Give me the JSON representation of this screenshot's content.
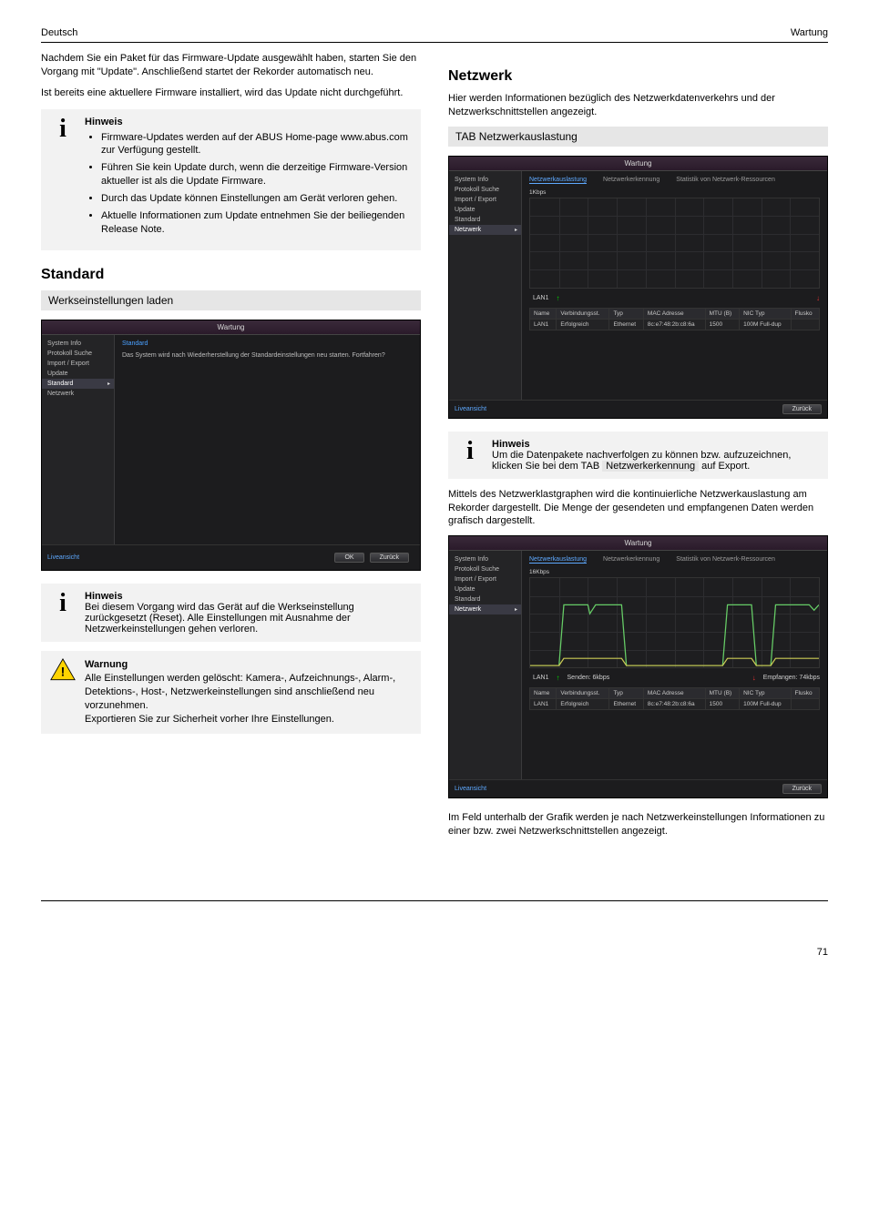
{
  "header": {
    "left": "Deutsch",
    "right": "Wartung"
  },
  "col_left": {
    "p1": "Nachdem Sie ein Paket für das Firmware-Update ausgewählt haben, starten Sie den Vorgang mit \"Update\". Anschließend startet der Rekorder automatisch neu.",
    "p2": "Ist bereits eine aktuellere Firmware installiert, wird das Update nicht durchgeführt.",
    "info1_title": "Hinweis",
    "info1_bullets": [
      "Firmware-Updates werden auf der ABUS Home-page www.abus.com zur Verfügung gestellt.",
      "Führen Sie kein Update durch, wenn die derzeitige Firmware-Version aktueller ist als die Update Firmware.",
      "Durch das Update können Einstellungen am Gerät verloren gehen.",
      "Aktuelle Informationen zum Update entnehmen Sie der beiliegenden Release Note."
    ],
    "section_standard": "Standard",
    "gray_bar_text": "Werkseinstellungen laden",
    "info2_title": "Hinweis",
    "info2_body": "Bei diesem Vorgang wird das Gerät auf die Werkseinstellung zurückgesetzt (Reset). Alle Einstellungen mit Ausnahme der Netzwerkeinstellungen gehen verloren.",
    "warn_title": "Warnung",
    "warn_body": "Alle Einstellungen werden gelöscht: Kamera-, Aufzeichnungs-, Alarm-, Detektions-, Host-, Netzwerkeinstellungen sind anschließend neu vorzunehmen.\nExportieren Sie zur Sicherheit vorher Ihre Einstellungen."
  },
  "col_right": {
    "section_netzwerk": "Netzwerk",
    "p1": "Hier werden Informationen bezüglich des Netzwerkdatenverkehrs und der Netzwerkschnittstellen angezeigt.",
    "tab_heading": "TAB Netzwerkauslastung",
    "info_title": "Hinweis",
    "info_body_pre": "Um die Datenpakete nachverfolgen zu können bzw. aufzuzeichnen, klicken Sie bei dem TAB ",
    "info_body_link": "Netzwerkerkennung",
    "info_body_post": " auf Export.",
    "p2": "Mittels des Netzwerklastgraphen wird die kontinuierliche Netzwerkauslastung am Rekorder dargestellt. Die Menge der gesendeten und empfangenen Daten werden grafisch dargestellt.",
    "p3": "Im Feld unterhalb der Grafik werden je nach Netzwerkeinstellungen Informationen zu einer bzw. zwei Netzwerkschnittstellen angezeigt."
  },
  "screenshot_common": {
    "title": "Wartung",
    "side_items": [
      "System Info",
      "Protokoll Suche",
      "Import / Export",
      "Update",
      "Standard",
      "Netzwerk"
    ],
    "live_link": "Liveansicht",
    "back_btn": "Zurück",
    "ok_btn": "OK"
  },
  "screenshot_standard": {
    "link": "Standard",
    "text": "Das System wird nach Wiederherstellung der Standardeinstellungen neu starten. Fortfahren?"
  },
  "screenshot_net": {
    "tabs": [
      "Netzwerkauslastung",
      "Netzwerkerkennung",
      "Statistik von Netzwerk-Ressourcen"
    ],
    "unit": "1Kbps",
    "lan": "LAN1",
    "send": "Senden: 6kbps",
    "recv": "Empfangen: 74kbps",
    "cols": [
      "Name",
      "Verbindungsst.",
      "Typ",
      "MAC Adresse",
      "MTU (B)",
      "NIC Typ",
      "Flusko"
    ],
    "row": [
      "LAN1",
      "Erfolgreich",
      "Ethernet",
      "8c:e7:48:2b:c8:6a",
      "1500",
      "100M Full-dup",
      ""
    ]
  },
  "chart_data": {
    "type": "line",
    "title": "Netzwerkauslastung",
    "ylabel": "kbps",
    "series": [
      {
        "name": "Senden",
        "color": "#6c6",
        "values_top": [
          0,
          0,
          0,
          0,
          0,
          0,
          0,
          0,
          0,
          0,
          0,
          0,
          0,
          0,
          0,
          0,
          0,
          0,
          0,
          0
        ]
      },
      {
        "name": "Empfangen",
        "color": "#cc5",
        "values_top": [
          0,
          0,
          0,
          0,
          0,
          0,
          0,
          0,
          0,
          0,
          0,
          0,
          0,
          0,
          0,
          0,
          0,
          0,
          0,
          0
        ]
      }
    ],
    "series_bottom": [
      {
        "name": "Senden",
        "color": "#6c6",
        "values": [
          0,
          0,
          6,
          6,
          6,
          6,
          0,
          0,
          0,
          0,
          0,
          0,
          0,
          0,
          6,
          6,
          0,
          6,
          6,
          6
        ]
      },
      {
        "name": "Empfangen",
        "color": "#cc5",
        "values": [
          0,
          0,
          74,
          74,
          74,
          74,
          0,
          0,
          0,
          0,
          0,
          0,
          0,
          0,
          74,
          74,
          0,
          74,
          74,
          74
        ]
      }
    ]
  },
  "footer": {
    "page": "71"
  }
}
